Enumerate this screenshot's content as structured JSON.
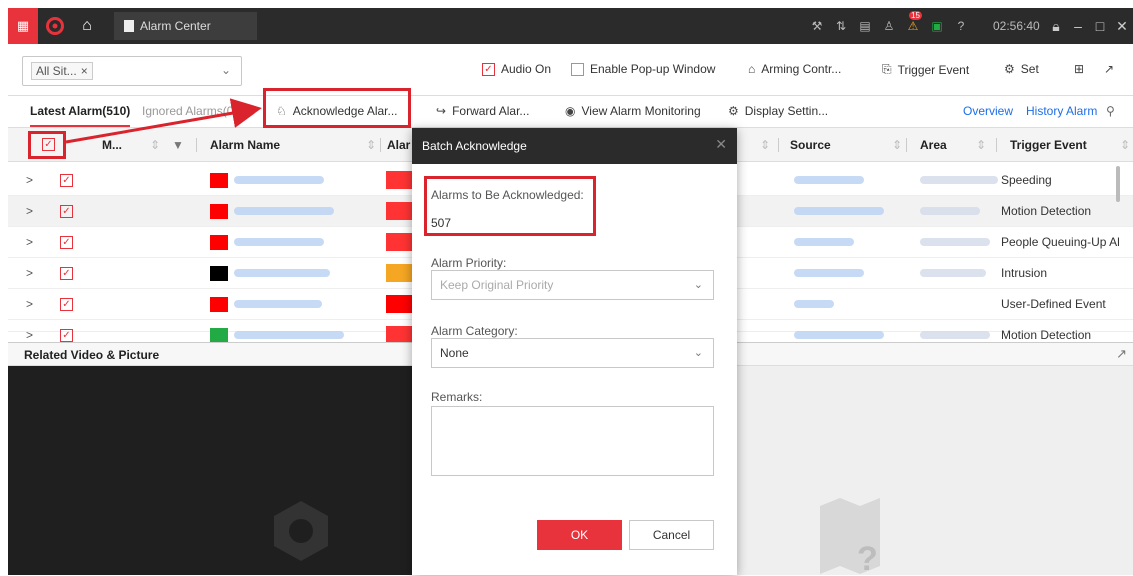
{
  "titlebar": {
    "tab_title": "Alarm Center",
    "time": "02:56:40",
    "alert_count": "15",
    "accent": "#e8323c"
  },
  "toolbar": {
    "site_selector_value": "All Sit...",
    "audio_on_label": "Audio On",
    "audio_on_checked": true,
    "popup_label": "Enable Pop-up Window",
    "popup_checked": false,
    "arming_label": "Arming Contr...",
    "trigger_event_label": "Trigger Event",
    "set_label": "Set"
  },
  "tabs": {
    "latest_label": "Latest Alarm(510)",
    "ignored_label": "Ignored Alarms(0)",
    "acknowledge_label": "Acknowledge Alar...",
    "forward_label": "Forward Alar...",
    "view_monitoring_label": "View Alarm Monitoring",
    "display_settings_label": "Display Settin...",
    "overview_label": "Overview",
    "history_label": "History Alarm"
  },
  "table": {
    "headers": {
      "mark": "M...",
      "alarm_name": "Alarm Name",
      "alarm_priority": "Alar",
      "source": "Source",
      "area": "Area",
      "trigger_event": "Trigger Event"
    },
    "rows": [
      {
        "priority_color": "#ff0000",
        "category_color": "#ff3333",
        "trigger": "Speeding"
      },
      {
        "priority_color": "#ff0000",
        "category_color": "#ff3333",
        "trigger": "Motion Detection"
      },
      {
        "priority_color": "#ff0000",
        "category_color": "#ff3333",
        "trigger": "People Queuing-Up Al"
      },
      {
        "priority_color": "#000000",
        "category_color": "#f5a623",
        "trigger": "Intrusion"
      },
      {
        "priority_color": "#ff0000",
        "category_color": "#ff0000",
        "trigger": "User-Defined Event"
      },
      {
        "priority_color": "#22aa44",
        "category_color": "#ff3333",
        "trigger": "Motion Detection"
      }
    ]
  },
  "related": {
    "title": "Related Video & Picture"
  },
  "dialog": {
    "title": "Batch Acknowledge",
    "alarms_label": "Alarms to Be Acknowledged:",
    "alarms_value": "507",
    "priority_label": "Alarm Priority:",
    "priority_value": "Keep Original Priority",
    "category_label": "Alarm Category:",
    "category_value": "None",
    "remarks_label": "Remarks:",
    "ok_label": "OK",
    "cancel_label": "Cancel"
  },
  "annotation_color": "#d9232d"
}
